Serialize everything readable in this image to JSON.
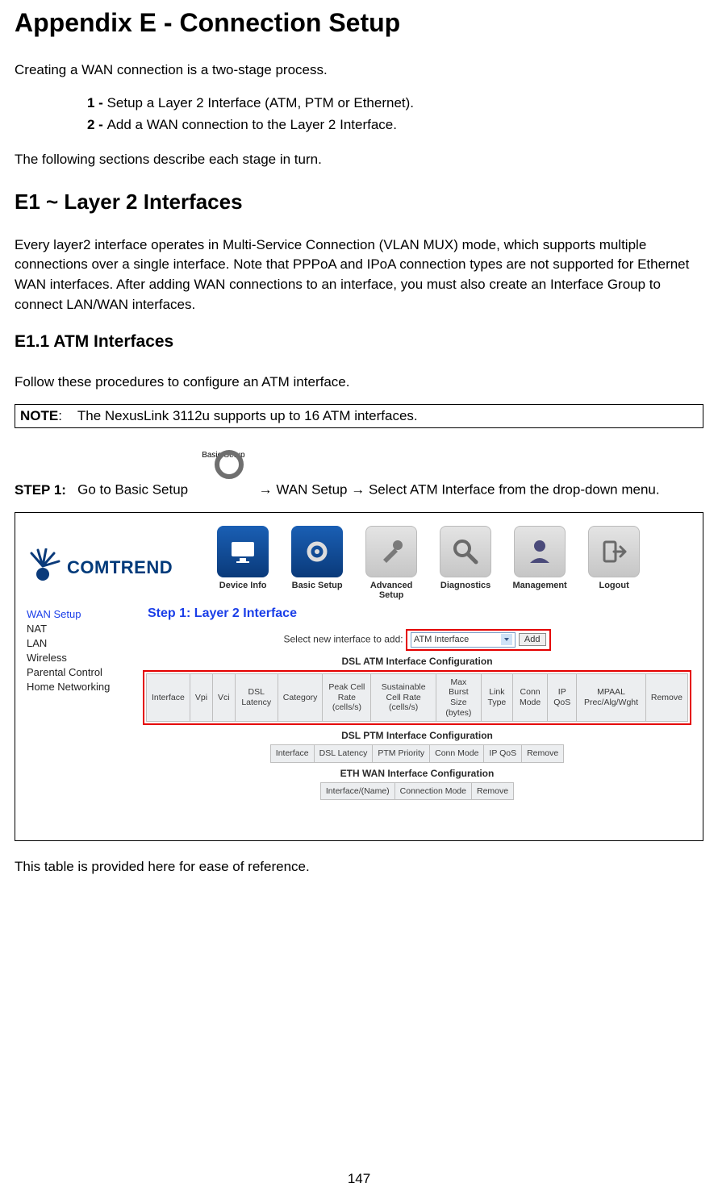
{
  "title": "Appendix E - Connection Setup",
  "intro": "Creating a WAN connection is a two-stage process.",
  "stage1_num": "1 - ",
  "stage1_text": "Setup a Layer 2 Interface (ATM, PTM or Ethernet).",
  "stage2_num": "2 - ",
  "stage2_text": "Add a WAN connection to the Layer 2 Interface.",
  "intro_followup": "The following sections describe each stage in turn.",
  "e1_title": "E1 ~ Layer 2 Interfaces",
  "e1_body": "Every layer2 interface operates in Multi-Service Connection (VLAN MUX) mode, which supports multiple connections over a single interface. Note that PPPoA and IPoA connection types are not supported for Ethernet WAN interfaces. After adding WAN connections to an interface, you must also create an Interface Group to connect LAN/WAN interfaces.",
  "e11_title": "E1.1 ATM Interfaces",
  "e11_body": "Follow these procedures to configure an ATM interface.",
  "note_label": "NOTE",
  "note_text": "The NexusLink 3112u supports up to 16 ATM interfaces.",
  "step1_label": "STEP 1:",
  "step1_before": "Go to Basic Setup",
  "step1_icon_label": "Basic Setup",
  "step1_after": " → WAN Setup → Select ATM Interface from the drop-down menu.",
  "closing_line": "This table is provided here for ease of reference.",
  "page_number": "147",
  "screenshot": {
    "logo_text": "COMTREND",
    "topnav": {
      "device_info": "Device Info",
      "basic_setup": "Basic Setup",
      "advanced_setup": "Advanced Setup",
      "diagnostics": "Diagnostics",
      "management": "Management",
      "logout": "Logout"
    },
    "sidenav": {
      "wan_setup": "WAN Setup",
      "nat": "NAT",
      "lan": "LAN",
      "wireless": "Wireless",
      "parental": "Parental Control",
      "home_net": "Home Networking"
    },
    "main": {
      "step_heading": "Step 1: Layer 2 Interface",
      "select_label": "Select new interface to add:",
      "select_value": "ATM Interface",
      "add_button": "Add",
      "atm_title": "DSL ATM Interface Configuration",
      "atm_headers": {
        "c0": "Interface",
        "c1": "Vpi",
        "c2": "Vci",
        "c3": "DSL Latency",
        "c4": "Category",
        "c5": "Peak Cell Rate (cells/s)",
        "c6": "Sustainable Cell Rate (cells/s)",
        "c7": "Max Burst Size (bytes)",
        "c8": "Link Type",
        "c9": "Conn Mode",
        "c10": "IP QoS",
        "c11": "MPAAL Prec/Alg/Wght",
        "c12": "Remove"
      },
      "ptm_title": "DSL PTM Interface Configuration",
      "ptm_headers": {
        "c0": "Interface",
        "c1": "DSL Latency",
        "c2": "PTM Priority",
        "c3": "Conn Mode",
        "c4": "IP QoS",
        "c5": "Remove"
      },
      "eth_title": "ETH WAN Interface Configuration",
      "eth_headers": {
        "c0": "Interface/(Name)",
        "c1": "Connection Mode",
        "c2": "Remove"
      }
    }
  }
}
